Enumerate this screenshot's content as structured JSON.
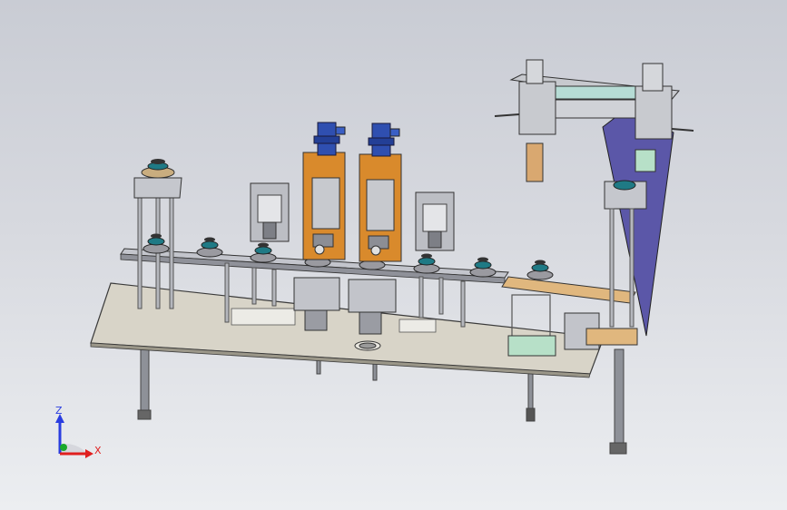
{
  "triad": {
    "z_label": "Z",
    "x_label": "X",
    "colors": {
      "z": "#2a3de0",
      "x": "#e01f1f",
      "y": "#1aa82a"
    }
  },
  "palette": {
    "background_top": "#c9ccd4",
    "background_bottom": "#eceef1",
    "plate": "#d8d4c8",
    "motor_blue": "#2f4fb0",
    "bracket_orange": "#d98a2c",
    "frame_purple": "#5b57a8",
    "ring_teal": "#1f7a85",
    "steel": "#b9bcc2",
    "guard_tan": "#e0b77e"
  }
}
